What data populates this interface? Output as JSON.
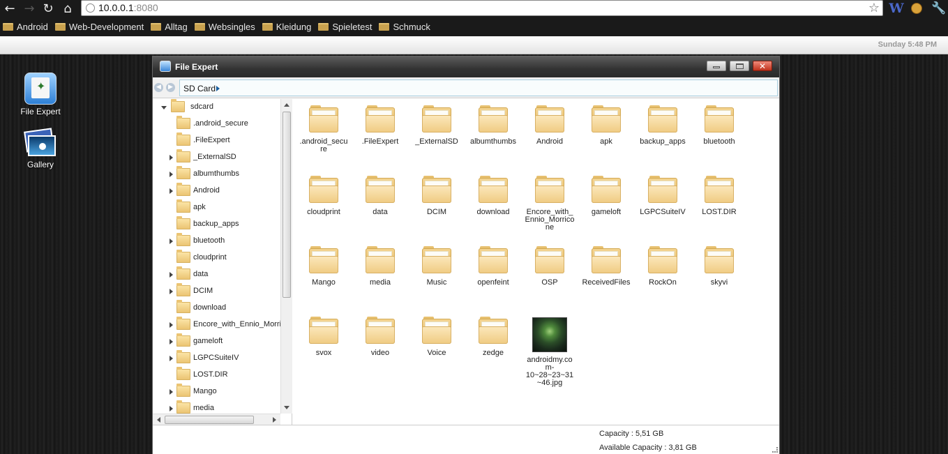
{
  "browser": {
    "url_host": "10.0.0.1",
    "url_port": ":8080",
    "bookmarks": [
      "Android",
      "Web-Development",
      "Alltag",
      "Websingles",
      "Kleidung",
      "Spieletest",
      "Schmuck"
    ]
  },
  "clock": "Sunday 5:48 PM",
  "desktop_icons": [
    {
      "label": "File Expert",
      "icon": "file-expert-icon"
    },
    {
      "label": "Gallery",
      "icon": "gallery-icon"
    }
  ],
  "window": {
    "title": "File Expert",
    "breadcrumb": "SD Card",
    "tree": [
      {
        "label": "sdcard",
        "expander": "open"
      },
      {
        "label": ".android_secure",
        "expander": "none"
      },
      {
        "label": ".FileExpert",
        "expander": "none"
      },
      {
        "label": "_ExternalSD",
        "expander": "closed"
      },
      {
        "label": "albumthumbs",
        "expander": "closed"
      },
      {
        "label": "Android",
        "expander": "closed"
      },
      {
        "label": "apk",
        "expander": "none"
      },
      {
        "label": "backup_apps",
        "expander": "none"
      },
      {
        "label": "bluetooth",
        "expander": "closed"
      },
      {
        "label": "cloudprint",
        "expander": "none"
      },
      {
        "label": "data",
        "expander": "closed"
      },
      {
        "label": "DCIM",
        "expander": "closed"
      },
      {
        "label": "download",
        "expander": "none"
      },
      {
        "label": "Encore_with_Ennio_Morri",
        "expander": "closed"
      },
      {
        "label": "gameloft",
        "expander": "closed"
      },
      {
        "label": "LGPCSuiteIV",
        "expander": "closed"
      },
      {
        "label": "LOST.DIR",
        "expander": "none"
      },
      {
        "label": "Mango",
        "expander": "closed"
      },
      {
        "label": "media",
        "expander": "closed"
      }
    ],
    "grid_items": [
      {
        "label": ".android_secure",
        "type": "folder"
      },
      {
        "label": ".FileExpert",
        "type": "folder"
      },
      {
        "label": "_ExternalSD",
        "type": "folder"
      },
      {
        "label": "albumthumbs",
        "type": "folder"
      },
      {
        "label": "Android",
        "type": "folder"
      },
      {
        "label": "apk",
        "type": "folder"
      },
      {
        "label": "backup_apps",
        "type": "folder"
      },
      {
        "label": "bluetooth",
        "type": "folder"
      },
      {
        "label": "cloudprint",
        "type": "folder"
      },
      {
        "label": "data",
        "type": "folder"
      },
      {
        "label": "DCIM",
        "type": "folder"
      },
      {
        "label": "download",
        "type": "folder"
      },
      {
        "label": "Encore_with_Ennio_Morricone",
        "type": "folder"
      },
      {
        "label": "gameloft",
        "type": "folder"
      },
      {
        "label": "LGPCSuiteIV",
        "type": "folder"
      },
      {
        "label": "LOST.DIR",
        "type": "folder"
      },
      {
        "label": "Mango",
        "type": "folder"
      },
      {
        "label": "media",
        "type": "folder"
      },
      {
        "label": "Music",
        "type": "folder"
      },
      {
        "label": "openfeint",
        "type": "folder"
      },
      {
        "label": "OSP",
        "type": "folder"
      },
      {
        "label": "ReceivedFiles",
        "type": "folder"
      },
      {
        "label": "RockOn",
        "type": "folder"
      },
      {
        "label": "skyvi",
        "type": "folder"
      },
      {
        "label": "svox",
        "type": "folder"
      },
      {
        "label": "video",
        "type": "folder"
      },
      {
        "label": "Voice",
        "type": "folder"
      },
      {
        "label": "zedge",
        "type": "folder"
      },
      {
        "label": "androidmy.com-10~28~23~31~46.jpg",
        "type": "image"
      }
    ],
    "status": {
      "capacity": "Capacity : 5,51 GB",
      "available": "Available Capacity : 3,81 GB"
    }
  }
}
